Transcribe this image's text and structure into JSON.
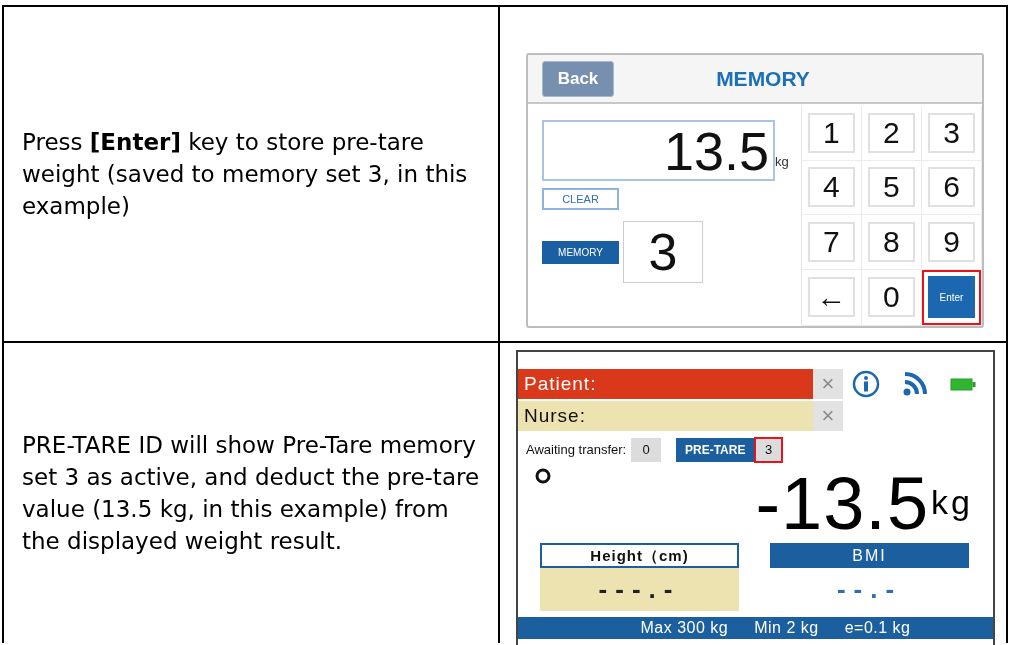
{
  "rows": [
    {
      "instruction": "Press **[Enter]** key to store pre-tare weight (saved to memory set 3, in this example)",
      "screen": {
        "kind": "memory",
        "back_button": {
          "label": "Back",
          "disabled": true
        },
        "title": "MEMORY",
        "weight_value": "13.5",
        "weight_unit": "kg",
        "clear_button": "CLEAR",
        "memory_button": "MEMORY",
        "memory_value": "3",
        "keys": [
          {
            "label": "1",
            "kind": "digit",
            "highlighted": false
          },
          {
            "label": "2",
            "kind": "digit",
            "highlighted": false
          },
          {
            "label": "3",
            "kind": "digit",
            "highlighted": false
          },
          {
            "label": "4",
            "kind": "digit",
            "highlighted": false
          },
          {
            "label": "5",
            "kind": "digit",
            "highlighted": false
          },
          {
            "label": "6",
            "kind": "digit",
            "highlighted": false
          },
          {
            "label": "7",
            "kind": "digit",
            "highlighted": false
          },
          {
            "label": "8",
            "kind": "digit",
            "highlighted": false
          },
          {
            "label": "9",
            "kind": "digit",
            "highlighted": false
          },
          {
            "label": "←",
            "kind": "digit",
            "highlighted": false
          },
          {
            "label": "0",
            "kind": "digit",
            "highlighted": false
          },
          {
            "label": "Enter",
            "kind": "enter",
            "highlighted": true
          }
        ]
      }
    },
    {
      "instruction": "PRE-TARE ID will show Pre-Tare memory set 3 as active, and deduct the pre-tare value (13.5 kg, in this example) from the displayed weight result.",
      "screen": {
        "kind": "display",
        "patient": {
          "label": "Patient:",
          "clear": "×"
        },
        "nurse": {
          "label": "Nurse:",
          "clear": "×"
        },
        "awaiting_label": "Awaiting transfer:",
        "awaiting_value": "0",
        "pretare_label": "PRE-TARE",
        "pretare_value": "3",
        "pretare_highlighted": true,
        "weight": "-13.5",
        "weight_unit": "kg",
        "height_label": "Height（cm)",
        "height_value": "---.-",
        "bmi_label": "BMI",
        "bmi_value": "--.-",
        "status_bar": [
          "Max 300 kg",
          "Min 2 kg",
          "e=0.1 kg"
        ]
      }
    }
  ]
}
